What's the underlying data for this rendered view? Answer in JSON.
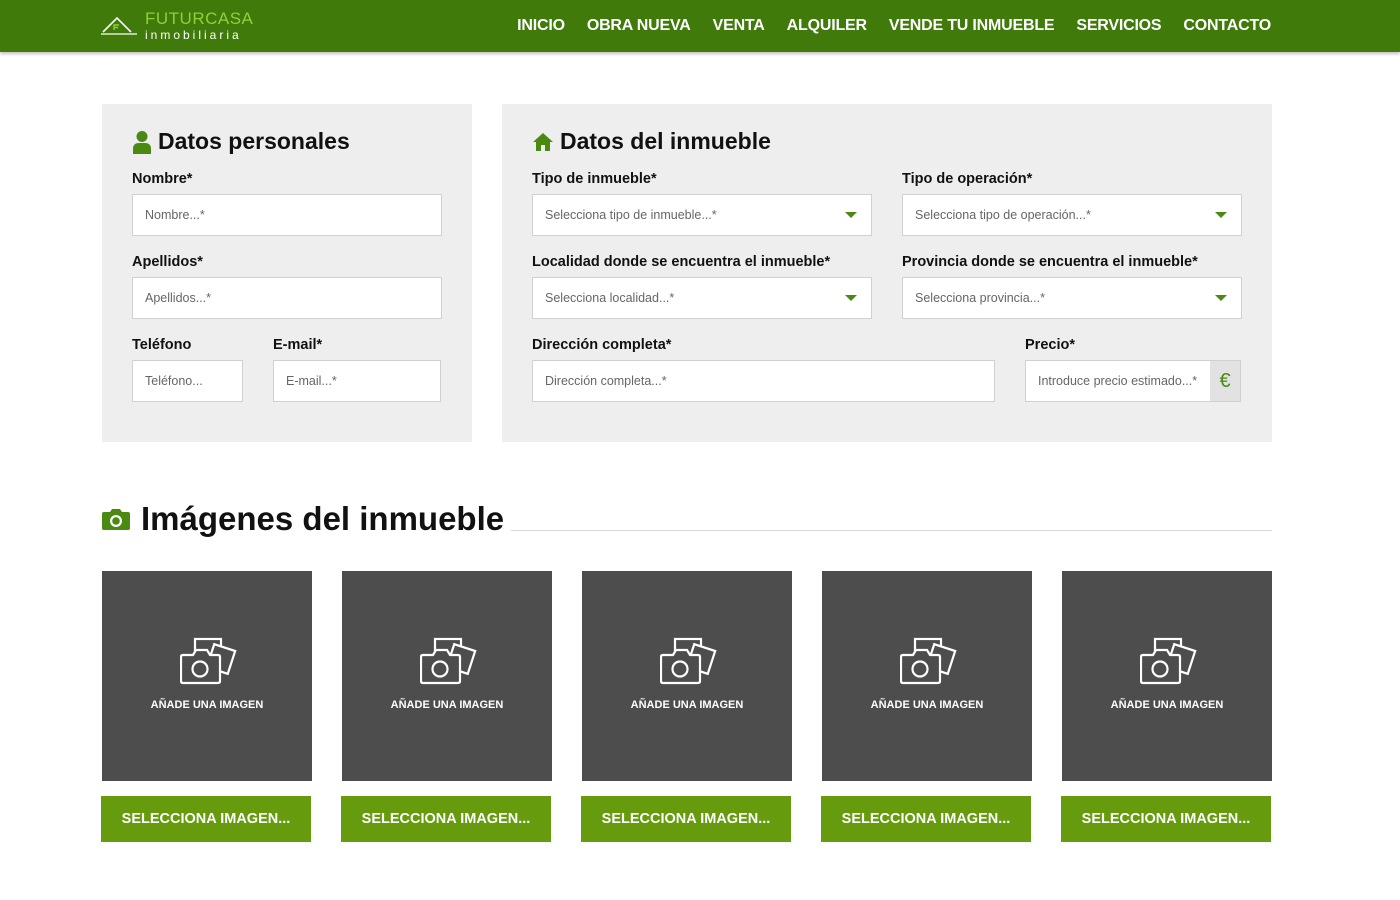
{
  "brand": {
    "name": "FUTURCASA",
    "sub": "inmobiliaria",
    "accent": "#3f7a0a",
    "button_color": "#659b0d",
    "light_green": "#8fd13a"
  },
  "nav": [
    "INICIO",
    "OBRA NUEVA",
    "VENTA",
    "ALQUILER",
    "VENDE TU INMUEBLE",
    "SERVICIOS",
    "CONTACTO"
  ],
  "personal": {
    "title": "Datos personales",
    "title_icon": "user-icon",
    "nombre": {
      "label": "Nombre*",
      "placeholder": "Nombre...*"
    },
    "apellidos": {
      "label": "Apellidos*",
      "placeholder": "Apellidos...*"
    },
    "telefono": {
      "label": "Teléfono",
      "placeholder": "Teléfono..."
    },
    "email": {
      "label": "E-mail*",
      "placeholder": "E-mail...*"
    }
  },
  "property": {
    "title": "Datos del inmueble",
    "title_icon": "home-icon",
    "tipo_inmueble": {
      "label": "Tipo de inmueble*",
      "value": "Selecciona tipo de inmueble...*"
    },
    "tipo_operacion": {
      "label": "Tipo de operación*",
      "value": "Selecciona tipo de operación...*"
    },
    "localidad": {
      "label": "Localidad donde se encuentra el inmueble*",
      "value": "Selecciona localidad...*"
    },
    "provincia": {
      "label": "Provincia donde se encuentra el inmueble*",
      "value": "Selecciona provincia...*"
    },
    "direccion": {
      "label": "Dirección completa*",
      "placeholder": "Dirección completa...*"
    },
    "precio": {
      "label": "Precio*",
      "placeholder": "Introduce precio estimado...*",
      "currency": "€"
    }
  },
  "images": {
    "title": "Imágenes del inmueble",
    "title_icon": "camera-icon",
    "tiles": [
      {
        "label": "AÑADE UNA IMAGEN",
        "button": "SELECCIONA IMAGEN..."
      },
      {
        "label": "AÑADE UNA IMAGEN",
        "button": "SELECCIONA IMAGEN..."
      },
      {
        "label": "AÑADE UNA IMAGEN",
        "button": "SELECCIONA IMAGEN..."
      },
      {
        "label": "AÑADE UNA IMAGEN",
        "button": "SELECCIONA IMAGEN..."
      },
      {
        "label": "AÑADE UNA IMAGEN",
        "button": "SELECCIONA IMAGEN..."
      }
    ]
  }
}
